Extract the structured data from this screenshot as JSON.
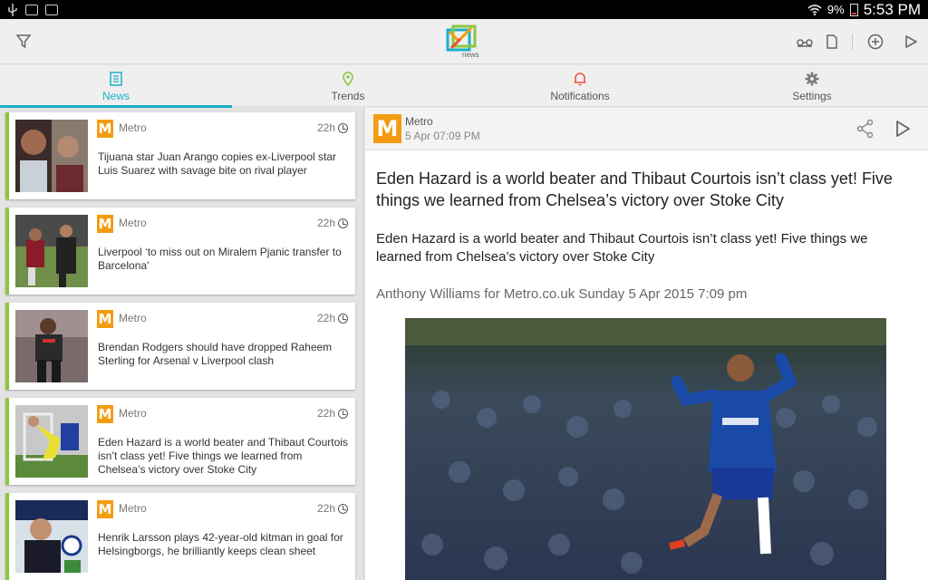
{
  "statusbar": {
    "battery_pct": "9%",
    "time": "5:53 PM"
  },
  "app": {
    "logo_text": "news"
  },
  "tabs": [
    {
      "label": "News",
      "icon": "news-icon",
      "active": true
    },
    {
      "label": "Trends",
      "icon": "location-pin-icon",
      "active": false
    },
    {
      "label": "Notifications",
      "icon": "bell-icon",
      "active": false
    },
    {
      "label": "Settings",
      "icon": "gear-icon",
      "active": false
    }
  ],
  "colors": {
    "accent": "#1ab0c8",
    "card_bar": "#8cc63f",
    "metro": "#f39c12",
    "notif": "#f0533a",
    "trend": "#8cc63f"
  },
  "list": [
    {
      "source": "Metro",
      "age": "22h",
      "title": "Tijuana star Juan Arango copies ex-Liverpool star Luis Suarez with savage bite on rival player"
    },
    {
      "source": "Metro",
      "age": "22h",
      "title": "Liverpool ‘to miss out on Miralem Pjanic transfer to Barcelona’"
    },
    {
      "source": "Metro",
      "age": "22h",
      "title": "Brendan Rodgers should have dropped Raheem Sterling for Arsenal v Liverpool clash"
    },
    {
      "source": "Metro",
      "age": "22h",
      "title": "Eden Hazard is a world beater and Thibaut Courtois isn’t class yet! Five things we learned from Chelsea’s victory over Stoke City"
    },
    {
      "source": "Metro",
      "age": "22h",
      "title": "Henrik Larsson plays 42-year-old kitman in goal for Helsingborgs, he brilliantly keeps clean sheet"
    }
  ],
  "article": {
    "source": "Metro",
    "date": "5 Apr 07:09 PM",
    "headline": "Eden Hazard is a world beater and Thibaut Courtois isn’t class yet! Five things we learned from Chelsea’s victory over Stoke City",
    "lead": "Eden Hazard is a world beater and Thibaut Courtois isn’t class yet! Five things we learned from Chelsea’s victory over Stoke City",
    "byline": "Anthony Williams for Metro.co.uk Sunday 5 Apr 2015 7:09 pm"
  }
}
